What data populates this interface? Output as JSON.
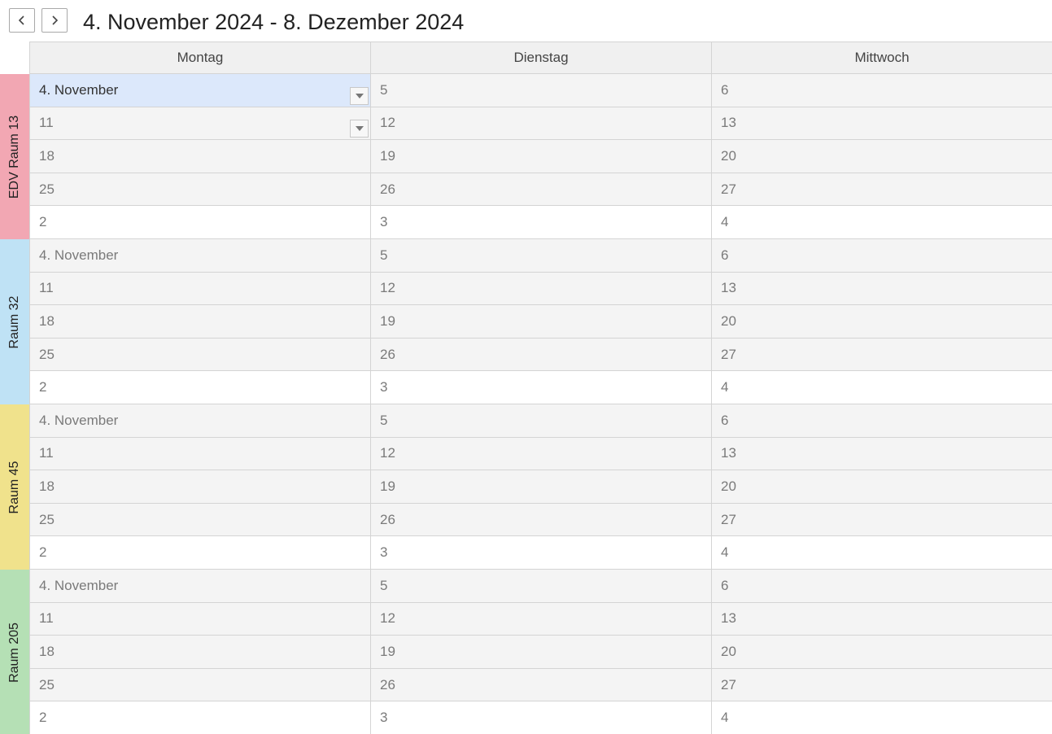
{
  "header": {
    "prev_icon": "chevron-left",
    "next_icon": "chevron-right",
    "range_title": "4. November 2024 - 8. Dezember 2024"
  },
  "columns": [
    "Montag",
    "Dienstag",
    "Mittwoch"
  ],
  "resources": [
    {
      "name": "EDV Raum 13",
      "color": "#f2a7b3"
    },
    {
      "name": "Raum 32",
      "color": "#bfe2f5"
    },
    {
      "name": "Raum 45",
      "color": "#f0e28c"
    },
    {
      "name": "Raum 205",
      "color": "#b5e0b5"
    }
  ],
  "weeks": [
    [
      "4. November",
      "5",
      "6"
    ],
    [
      "11",
      "12",
      "13"
    ],
    [
      "18",
      "19",
      "20"
    ],
    [
      "25",
      "26",
      "27"
    ],
    [
      "2",
      "3",
      "4"
    ]
  ],
  "selected_cell": {
    "resource": 0,
    "week": 0,
    "day": 0
  },
  "dropdown_cells": [
    {
      "resource": 0,
      "week": 0,
      "day": 0
    },
    {
      "resource": 0,
      "week": 1,
      "day": 0
    }
  ],
  "other_month_week": 4
}
